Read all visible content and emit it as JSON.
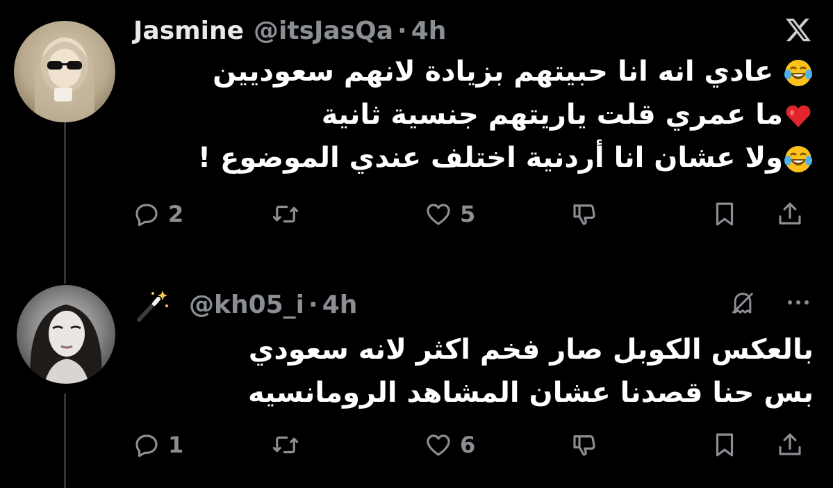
{
  "tweets": [
    {
      "name": "Jasmine",
      "handle": "@itsJasQa",
      "dot": "·",
      "time": "4h",
      "lines": [
        "عادي انه انا حبيتهم بزيادة لانهم سعوديين",
        "ما عمري قلت ياريتهم جنسية ثانية",
        "ولا عشان انا أردنية اختلف عندي الموضوع !"
      ],
      "emoji": [
        "laughing-tears",
        "red-heart",
        "laughing-tears"
      ],
      "replies": "2",
      "likes": "5"
    },
    {
      "handle": "@kh05_i",
      "dot": "·",
      "time": "4h",
      "lines": [
        "بالعكس الكوبل صار فخم اكثر لانه سعودي",
        "بس حنا قصدنا عشان المشاهد الرومانسيه"
      ],
      "replies": "1",
      "likes": "6"
    }
  ],
  "icons": {
    "brand": "x-logo",
    "actions": [
      "reply-icon",
      "repost-icon",
      "like-icon",
      "dislike-icon",
      "bookmark-icon",
      "share-icon"
    ],
    "second_tweet": [
      "magic-wand-icon",
      "muted-ghost-icon",
      "more-icon"
    ]
  },
  "colors": {
    "background": "#000000",
    "text": "#ffffff",
    "secondary": "#8b8f94",
    "thread_line": "#333639"
  }
}
